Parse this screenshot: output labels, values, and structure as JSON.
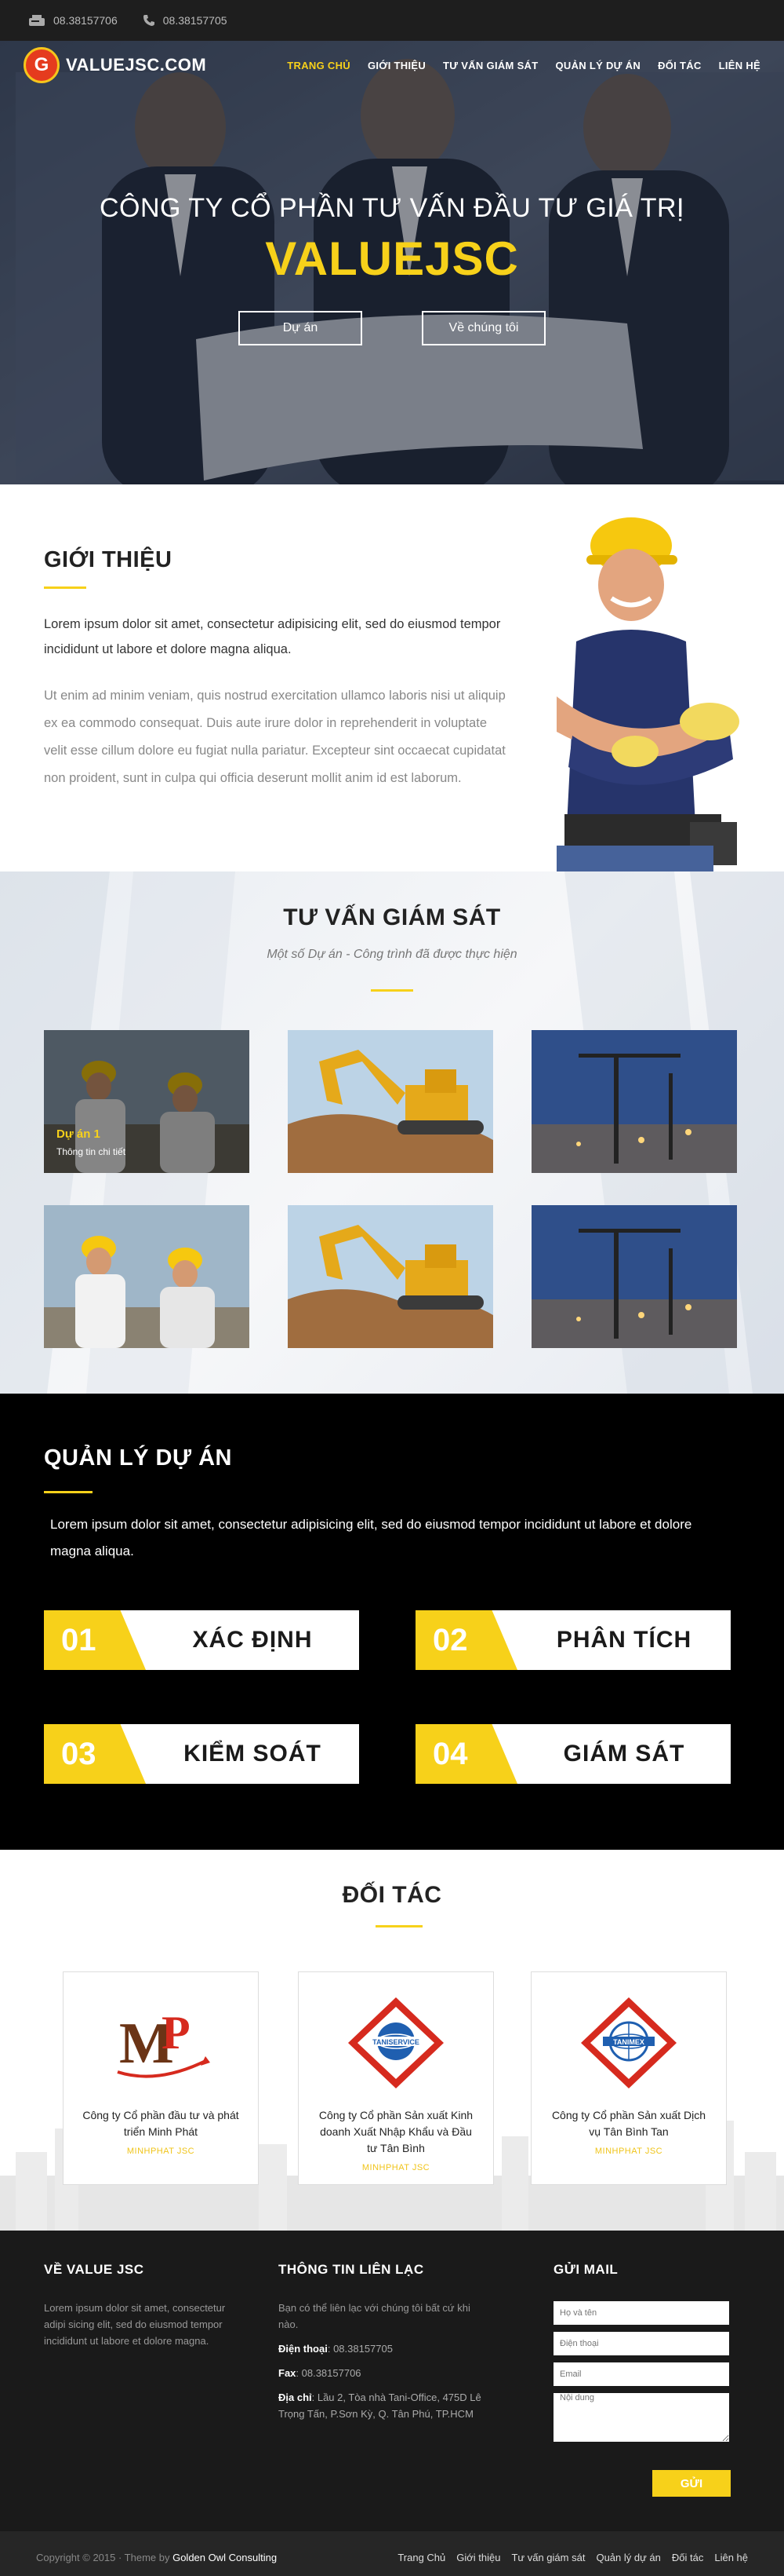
{
  "topbar": {
    "phone1": "08.38157706",
    "phone2": "08.38157705"
  },
  "brand": {
    "logo_letter": "G",
    "name": "VALUEJSC.COM"
  },
  "nav": [
    {
      "label": "TRANG CHỦ",
      "active": true
    },
    {
      "label": "GIỚI THIỆU"
    },
    {
      "label": "TƯ VẤN GIÁM SÁT"
    },
    {
      "label": "QUẢN LÝ DỰ ÁN"
    },
    {
      "label": "ĐỐI TÁC"
    },
    {
      "label": "LIÊN HỆ"
    }
  ],
  "hero": {
    "subtitle": "CÔNG TY CỔ PHẦN TƯ VẤN ĐẦU TƯ GIÁ TRỊ",
    "title": "VALUEJSC",
    "btn_projects": "Dự án",
    "btn_about": "Về chúng tôi"
  },
  "intro": {
    "title": "GIỚI THIỆU",
    "lead": "Lorem ipsum dolor sit amet, consectetur adipisicing elit, sed do eiusmod tempor incididunt ut labore et dolore magna aliqua.",
    "body": "Ut enim ad minim veniam, quis nostrud exercitation ullamco laboris nisi ut aliquip ex ea commodo consequat. Duis aute irure dolor in reprehenderit in voluptate velit esse cillum dolore eu fugiat nulla pariatur. Excepteur sint occaecat cupidatat non proident, sunt in culpa qui officia deserunt mollit anim id est laborum."
  },
  "consult": {
    "title": "TƯ VẤN GIÁM SÁT",
    "subtitle": "Một số Dự án - Công trình đã được thực hiện",
    "featured_label": "Dự án 1",
    "featured_detail": "Thông tin chi tiết"
  },
  "management": {
    "title": "QUẢN LÝ DỰ ÁN",
    "text": "Lorem ipsum dolor sit amet, consectetur adipisicing elit, sed do eiusmod tempor incididunt ut labore et dolore magna aliqua.",
    "steps": [
      {
        "num": "01",
        "label": "XÁC ĐỊNH"
      },
      {
        "num": "02",
        "label": "PHÂN TÍCH"
      },
      {
        "num": "03",
        "label": "KIỂM SOÁT"
      },
      {
        "num": "04",
        "label": "GIÁM SÁT"
      }
    ]
  },
  "partners": {
    "title": "ĐỐI TÁC",
    "items": [
      {
        "name": "Công ty Cổ phần đầu tư và phát triển Minh Phát",
        "tag": "MINHPHAT JSC",
        "logo_text": "MP"
      },
      {
        "name": "Công ty Cổ phần Sản xuất Kinh doanh Xuất Nhập Khẩu và Đầu tư Tân Bình",
        "tag": "MINHPHAT JSC",
        "logo_text": "TANISERVICE"
      },
      {
        "name": "Công ty Cổ phần Sản xuất Dịch vụ Tân Bình Tan",
        "tag": "MINHPHAT JSC",
        "logo_text": "TANIMEX"
      }
    ]
  },
  "footer": {
    "about_title": "VỀ VALUE JSC",
    "about_text": "Lorem ipsum dolor sit amet, consectetur adipi sicing elit, sed do eiusmod tempor incididunt ut labore et dolore magna.",
    "contact_title": "THÔNG TIN LIÊN LẠC",
    "contact_intro": "Bạn có thể liên lạc với chúng tôi bất cứ khi nào.",
    "phone_label": "Điện thoại",
    "phone": ": 08.38157705",
    "fax_label": "Fax",
    "fax": ": 08.38157706",
    "address_label": "Địa chỉ",
    "address": ": Lầu 2, Tòa nhà Tani-Office, 475D Lê Trọng Tấn, P.Sơn Kỳ, Q. Tân Phú, TP.HCM",
    "mail_title": "GỬI MAIL",
    "ph_name": "Họ và tên",
    "ph_phone": "Điện thoại",
    "ph_email": "Email",
    "ph_content": "Nội dung",
    "send": "GỬI"
  },
  "bottom": {
    "copyright": "Copyright © 2015 · Theme by ",
    "author": "Golden Owl Consulting",
    "menu": [
      "Trang Chủ",
      "Giới thiệu",
      "Tư vấn giám sát",
      "Quản lý dự án",
      "Đối tác",
      "Liên hệ"
    ]
  },
  "colors": {
    "accent": "#f7d11a",
    "dark": "#1a1a1a"
  },
  "icons": {
    "topbar_phone1": "fax-icon",
    "topbar_phone2": "phone-icon"
  }
}
